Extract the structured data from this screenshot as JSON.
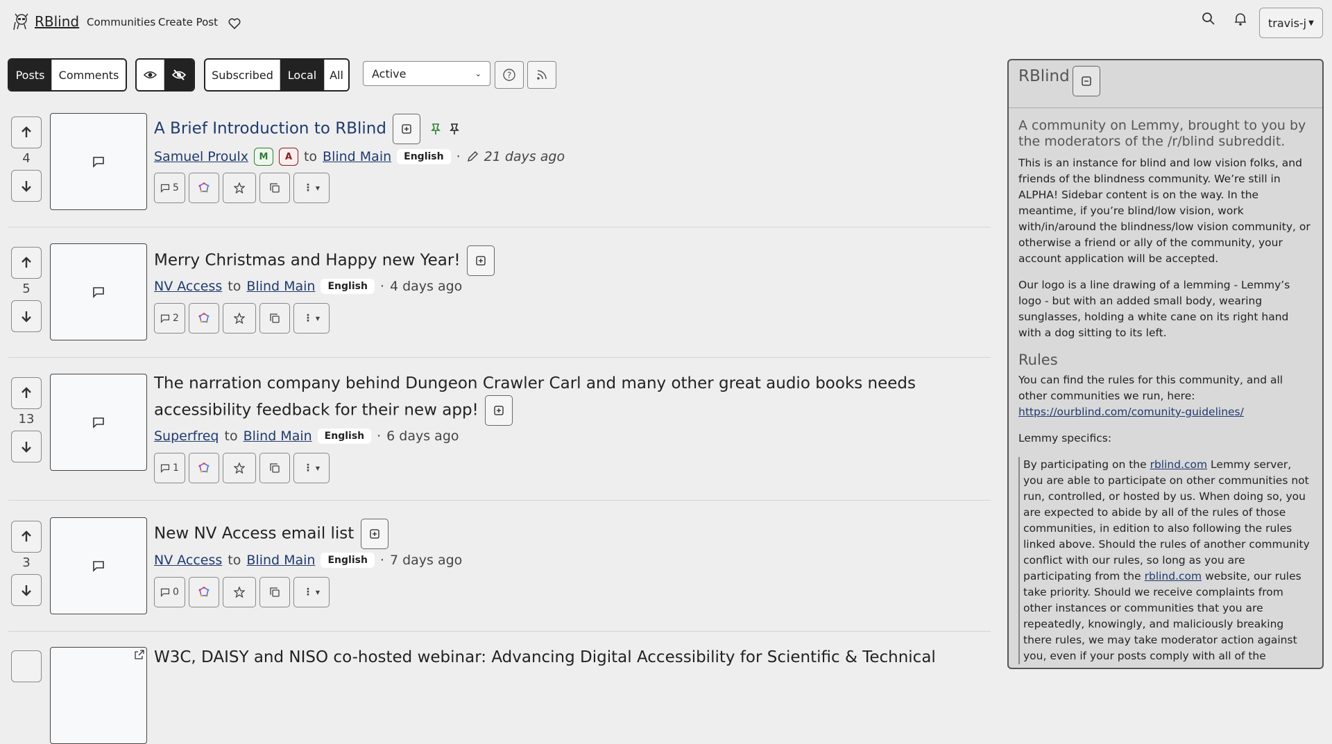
{
  "nav": {
    "brand": "RBlind",
    "communities": "Communities",
    "create_post": "Create Post",
    "user": "travis-j"
  },
  "filters": {
    "type": [
      "Posts",
      "Comments"
    ],
    "type_active": "Posts",
    "listing": [
      "Subscribed",
      "Local",
      "All"
    ],
    "listing_active": "Local",
    "sort": "Active"
  },
  "posts": [
    {
      "score": "4",
      "title": "A Brief Introduction to RBlind",
      "author": "Samuel Proulx",
      "badges": [
        "M",
        "A"
      ],
      "to": "to",
      "community": "Blind Main",
      "language": "English",
      "time": "21 days ago",
      "comments": "5"
    },
    {
      "score": "5",
      "title": "Merry Christmas and Happy new Year!",
      "author": "NV Access",
      "to": "to",
      "community": "Blind Main",
      "language": "English",
      "time": "4 days ago",
      "comments": "2"
    },
    {
      "score": "13",
      "title_line1": "The narration company behind Dungeon Crawler Carl and many other great audio books needs",
      "title_line2": "accessibility feedback for their new app!",
      "author": "Superfreq",
      "to": "to",
      "community": "Blind Main",
      "language": "English",
      "time": "6 days ago",
      "comments": "1"
    },
    {
      "score": "3",
      "title": "New NV Access email list",
      "author": "NV Access",
      "to": "to",
      "community": "Blind Main",
      "language": "English",
      "time": "7 days ago",
      "comments": "0"
    },
    {
      "title": "W3C, DAISY and NISO co-hosted webinar: Advancing Digital Accessibility for Scientific & Technical"
    }
  ],
  "sidebar": {
    "title": "RBlind",
    "tagline": "A community on Lemmy, brought to you by the moderators of the /r/blind subreddit.",
    "p1": "This is an instance for blind and low vision folks, and friends of the blindness community. We’re still in ALPHA! Sidebar content is on the way. In the meantime, if you’re blind/low vision, work with/in/around the blindness/low vision community, or otherwise a friend or ally of the community, your account application will be accepted.",
    "p2": "Our logo is a line drawing of a lemming - Lemmy’s logo - but with an added small body, wearing sunglasses, holding a white cane on its right hand with a dog sitting to its left.",
    "rules_heading": "Rules",
    "rules_text": "You can find the rules for this community, and all other communities we run, here:",
    "rules_link": "https://ourblind.com/comunity-guidelines/",
    "lemmy_specifics": "Lemmy specifics:",
    "q_a": "By participating on the",
    "q_link1": "rblind.com",
    "q_b": "Lemmy server, you are able to participate on other communities not run, controlled, or hosted by us. When doing so, you are expected to abide by all of the rules of those communities, in edition to also following the rules linked above. Should the rules of another community conflict with our rules, so long as you are participating from the",
    "q_link2": "rblind.com",
    "q_c": "website, our rules take priority. Should we receive complaints from other instances or communities that you are repeatedly, knowingly, and maliciously breaking there rules, we may take moderator action against you, even if your posts comply with all of the"
  }
}
